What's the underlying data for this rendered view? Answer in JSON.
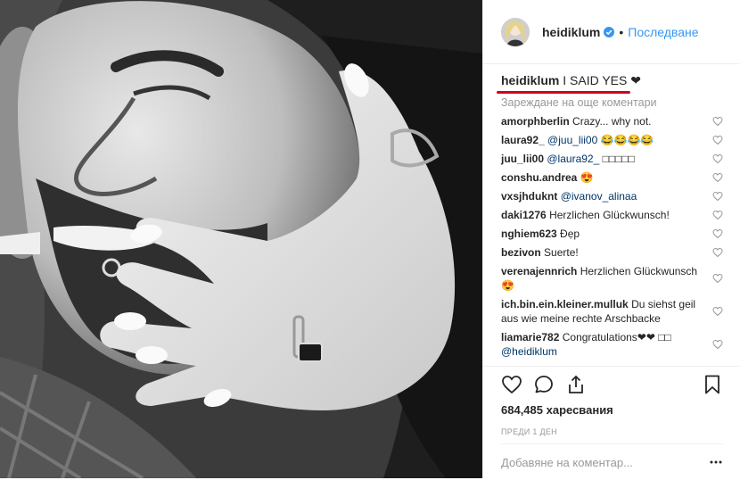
{
  "post": {
    "image": {
      "description": "Black-and-white close-up photo of a smiling man with a woman's hand over his mouth wearing an engagement ring"
    }
  },
  "header": {
    "username": "heidiklum",
    "separator": "•",
    "follow_label": "Последване"
  },
  "caption": {
    "username": "heidiklum",
    "text": "I SAID YES ❤"
  },
  "load_more": "Зареждане на още коментари",
  "comments": [
    {
      "user": "amorphberlin",
      "text": "Crazy... why not."
    },
    {
      "user": "laura92_",
      "mention": "@juu_lii00",
      "text": "😂😂😂😂"
    },
    {
      "user": "juu_lii00",
      "mention": "@laura92_",
      "text": "□□□□□"
    },
    {
      "user": "conshu.andrea",
      "text": "😍"
    },
    {
      "user": "vxsjhduknt",
      "mention": "@ivanov_alinaa",
      "text": ""
    },
    {
      "user": "daki1276",
      "text": "Herzlichen Glückwunsch!"
    },
    {
      "user": "nghiem623",
      "text": "Đẹp"
    },
    {
      "user": "bezivon",
      "text": "Suerte!"
    },
    {
      "user": "verenajennrich",
      "text": "Herzlichen Glückwunsch 😍"
    },
    {
      "user": "ich.bin.ein.kleiner.mulluk",
      "text": "Du siehst geil aus wie meine rechte Arschbacke"
    },
    {
      "user": "liamarie782",
      "text": "Congratulations❤❤ □□",
      "mention_after": "@heidiklum"
    }
  ],
  "actions": {
    "likes": "684,485 харесвания",
    "time": "ПРЕДИ 1 ДЕН",
    "add_comment_placeholder": "Добавяне на коментар..."
  },
  "colors": {
    "link": "#3897f0",
    "mention": "#003569",
    "underline": "#d0021b",
    "muted": "#999999"
  }
}
